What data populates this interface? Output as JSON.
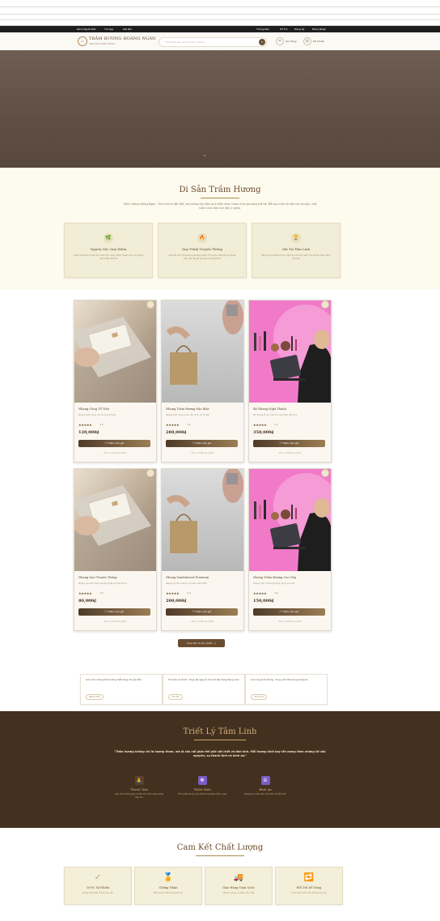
{
  "topbar": {
    "left_links": [
      "Kênh Người Bán",
      "Tải App",
      "Kết Nối"
    ],
    "right_links": [
      "Thông Báo",
      "Hỗ Trợ",
      "Đăng Ký",
      "Đăng Nhập"
    ]
  },
  "header": {
    "brand": "TRẦM HƯƠNG HOÀNG NGÂN",
    "brand_sub": "TINH HOA TRẦM HƯƠNG",
    "search_placeholder": "Tìm kiếm sản phẩm trầm hương...",
    "cart_label": "Giỏ hàng",
    "account_label": "Tài khoản"
  },
  "heritage": {
    "title": "Di Sản Trầm Hương",
    "intro": "Trầm Hương Hoàng Ngân - Tinh hoa từ đất Việt, nơi những cây trầm quý hiếm được chăm chút qua từng thế hệ. Mỗi que trầm là một câu chuyện, một hành trình tâm linh đầy ý nghĩa.",
    "cards": [
      {
        "icon": "leaf-icon",
        "glyph": "🌿",
        "title": "Nguồn Gốc Quý Hiếm",
        "desc": "Trầm hương tự nhiên thu hoạch từ rừng, được tuyển chọn kỹ lưỡng qua nhiều thế hệ"
      },
      {
        "icon": "flame-icon",
        "glyph": "🔥",
        "title": "Quy Trình Truyền Thống",
        "desc": "Chế tác thủ công theo phương pháp cổ truyền, kết hợp kỹ thuật hiện đại để giữ nguyên hương thơm"
      },
      {
        "icon": "trophy-icon",
        "glyph": "🏆",
        "title": "Giá Trị Tâm Linh",
        "desc": "Mang lại sự thanh tịnh, bình an và may mắn cho không gian sống của bạn"
      }
    ]
  },
  "products": [
    {
      "name": "Nhang Cũng Tổ Tiên",
      "desc": "Nhang trầm dùng cho lễ cúng tổ tiên",
      "rating": "★★★★★",
      "count": "(24)",
      "price": "120,000₫",
      "cart": "Thêm vào giỏ",
      "detail": "Xem chi tiết sản phẩm",
      "image": "card"
    },
    {
      "name": "Nhang Trầm Hương Đặc Biệt",
      "desc": "Nhang trầm hương cao cấp chọn lọc từ đất",
      "rating": "★★★★★",
      "count": "(18)",
      "price": "280,000₫",
      "cart": "Thêm vào giỏ",
      "detail": "Xem chi tiết sản phẩm",
      "image": "bag"
    },
    {
      "name": "Bộ Nhang Nghi Thánh",
      "desc": "Bộ nhang lễ cao cấp cho nghi thức tâm linh",
      "rating": "★★★★★",
      "count": "(12)",
      "price": "350,000₫",
      "cart": "Thêm vào giỏ",
      "detail": "Xem chi tiết sản phẩm",
      "image": "pink"
    },
    {
      "name": "Nhang Que Truyền Thống",
      "desc": "Nhang que làm theo phương pháp truyền thống",
      "rating": "★★★★★",
      "count": "(32)",
      "price": "80,000₫",
      "cart": "Thêm vào giỏ",
      "detail": "Xem chi tiết sản phẩm",
      "image": "card"
    },
    {
      "name": "Nhang Sandalwood Premium",
      "desc": "Nhang gỗ đàn hương cao cấp nhập khẩu",
      "rating": "★★★★★",
      "count": "(15)",
      "price": "200,000₫",
      "cart": "Thêm vào giỏ",
      "detail": "Xem chi tiết sản phẩm",
      "image": "bag"
    },
    {
      "name": "Nhang Trầm Hương Cao Cấp",
      "desc": "Nhang trầm hương thượng hạng loại một",
      "rating": "★★★★★",
      "count": "(20)",
      "price": "150,000₫",
      "cart": "Thêm vào giỏ",
      "detail": "Xem chi tiết sản phẩm",
      "image": "pink"
    }
  ],
  "view_all": "Xem tất cả sản phẩm →",
  "quotes": [
    {
      "text": "Linh chọn nhang trầm hương chất lượng cho gia đình",
      "tag": "Nhang Trầm"
    },
    {
      "text": "Tinh dầu và chính · Cũng dịp ngày lễ cách chi tiêu hàng tháng cách",
      "tag": "Tinh dầu"
    },
    {
      "text": "Linh vòng trầm thông · Vòng cách theo trọng lượng bộ",
      "tag": "Vòng trầm"
    }
  ],
  "philosophy": {
    "title": "Triết Lý Tâm Linh",
    "quote": "\"Trầm hương không chỉ là hương thơm, mà là cầu nối giữa thế giới vật chất và tâm linh. Mỗi hương khói bay lên mang theo những lời cầu nguyện, sự thanh tịnh và bình an.\"",
    "items": [
      {
        "icon": "pray-icon",
        "glyph": "🙏",
        "title": "Thanh Tịnh",
        "desc": "Làm sạch không gian và tâm hồn khỏi năng lượng tiêu cực"
      },
      {
        "icon": "meditation-icon",
        "glyph": "☸",
        "title": "Thiền Định",
        "desc": "Hỗ trợ tập trung và an định trong thiền định, yoga"
      },
      {
        "icon": "peace-icon",
        "glyph": "☮",
        "title": "Bình An",
        "desc": "Mang lại sự yên bình, thư thái cho tâm hồn"
      }
    ]
  },
  "quality": {
    "title": "Cam Kết Chất Lượng",
    "items": [
      {
        "icon": "check-icon",
        "glyph": "✓",
        "title": "100% Tự Nhiên",
        "desc": "Không hóa chất, không hạn, độc"
      },
      {
        "icon": "medal-icon",
        "glyph": "🏅",
        "title": "Chứng Nhận",
        "desc": "Đạt chuẩn chất lượng quốc tế"
      },
      {
        "icon": "truck-icon",
        "glyph": "🚚",
        "title": "Giao Hàng Toàn Quốc",
        "desc": "Nhanh chóng, an toàn, bảo mật"
      },
      {
        "icon": "return-icon",
        "glyph": "🔁",
        "title": "Đổi Trả Dễ Dàng",
        "desc": "Hoàn tiền 100% nếu không hài lòng"
      }
    ]
  },
  "colors": {
    "hero": "#5e4e44",
    "accent": "#b08a55",
    "dark": "#43301f",
    "cream": "#fdfaee"
  }
}
